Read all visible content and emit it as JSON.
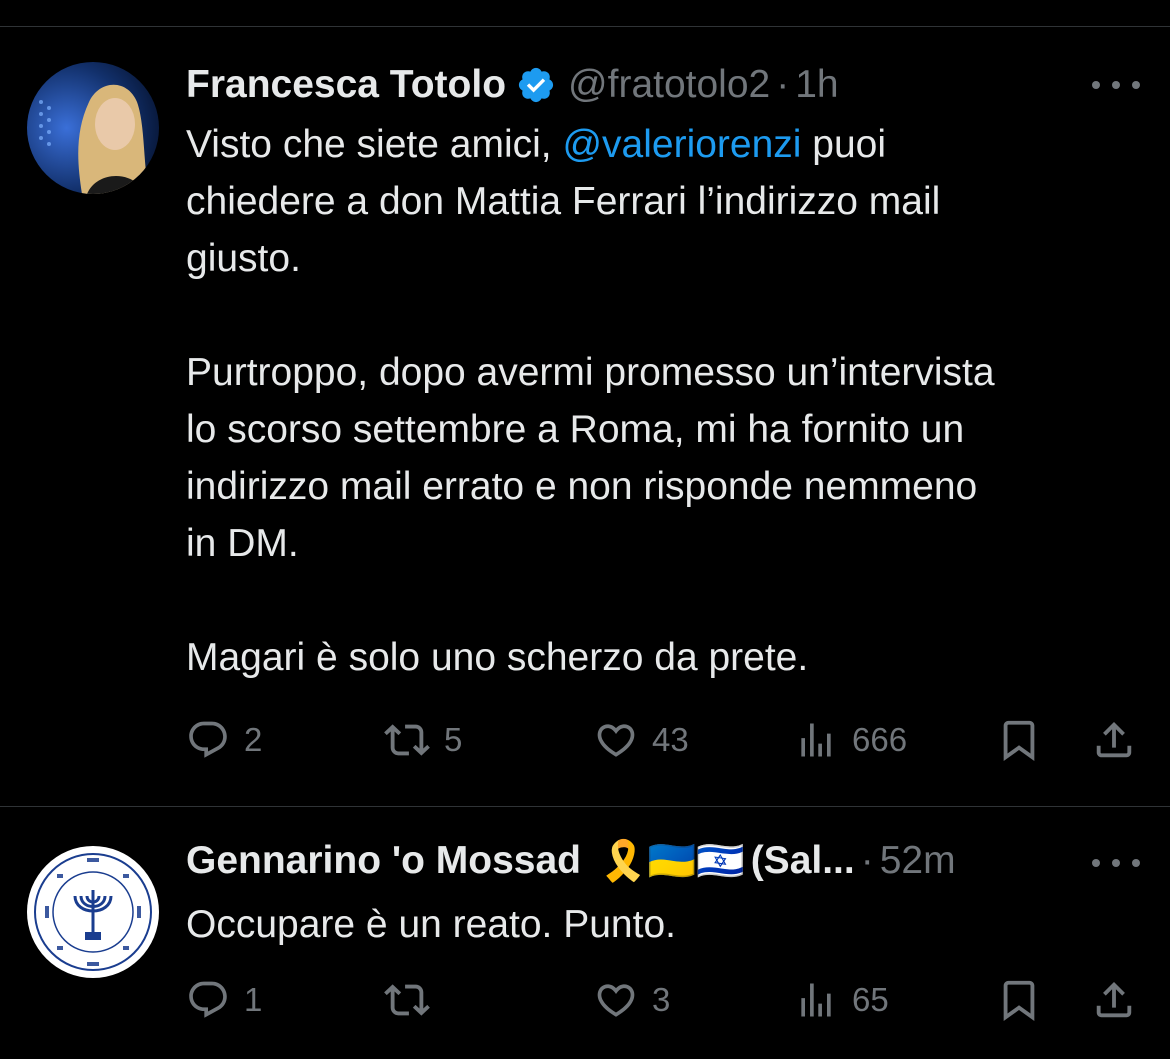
{
  "tweets": [
    {
      "author_name": "Francesca Totolo",
      "verified": true,
      "handle": "@fratotolo2",
      "time": "1h",
      "text_before": "Visto che siete amici, ",
      "mention": "@valeriorenzi",
      "text_after": " puoi\nchiedere a don Mattia Ferrari l’indirizzo mail\ngiusto.\n\nPurtroppo, dopo avermi promesso un’intervista\nlo scorso settembre a Roma, mi ha fornito un\nindirizzo mail errato e non risponde nemmeno\nin DM.\n\nMagari è solo uno scherzo da prete.",
      "replies": "2",
      "reposts": "5",
      "likes": "43",
      "views": "666"
    },
    {
      "author_name": "Gennarino 'o Mossad",
      "author_emojis": "🎗️🇺🇦🇮🇱",
      "author_suffix": "(Sal...",
      "time": "52m",
      "text": "Occupare è un reato. Punto.",
      "replies": "1",
      "reposts": "",
      "likes": "3",
      "views": "65"
    }
  ],
  "colors": {
    "background": "#000000",
    "text": "#e7e9ea",
    "secondary": "#71767b",
    "link": "#1d9bf0",
    "verified": "#1d9bf0",
    "divider": "#2f3336"
  }
}
